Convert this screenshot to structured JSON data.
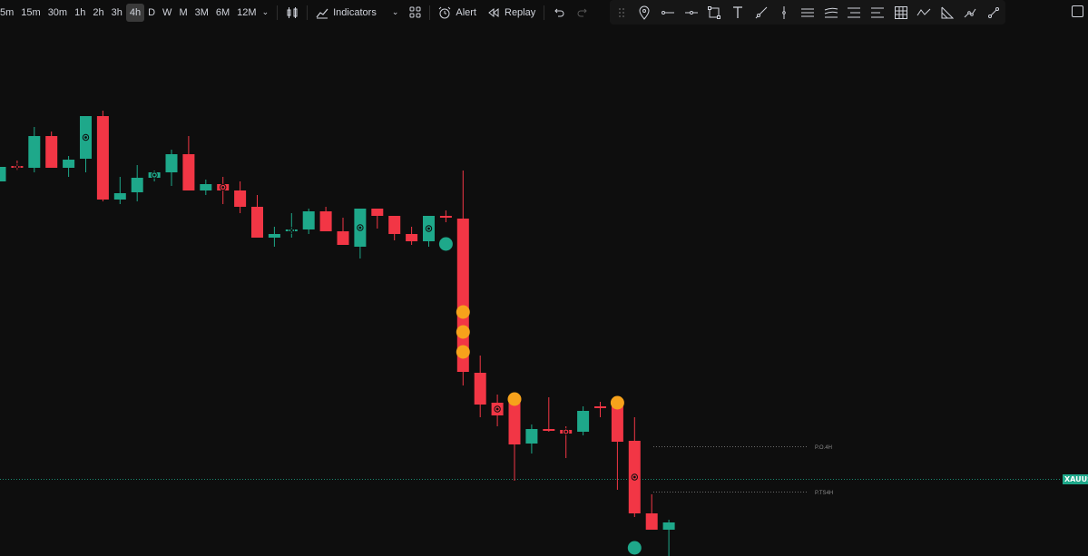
{
  "toolbar": {
    "timeframes": [
      "5m",
      "15m",
      "30m",
      "1h",
      "2h",
      "3h",
      "4h",
      "D",
      "W",
      "M",
      "3M",
      "6M",
      "12M"
    ],
    "active_timeframe": "4h",
    "indicators_label": "Indicators",
    "alert_label": "Alert",
    "replay_label": "Replay"
  },
  "drawing_tools": [
    "drag-handle-icon",
    "pin-icon",
    "trend-line-icon",
    "horizontal-ray-icon",
    "rectangle-icon",
    "text-icon",
    "ray-icon",
    "vertical-line-icon",
    "parallel-channel-icon",
    "pitchfork-icon",
    "fib-retracement-icon",
    "fib-extension-icon",
    "gann-box-icon",
    "zigzag-icon",
    "triangle-icon",
    "path-icon",
    "brush-icon"
  ],
  "chart": {
    "symbol_tag": "XAUUS",
    "labels": {
      "po4h": "P.O.4H",
      "pts4h": "P.TS4H"
    },
    "colors": {
      "up": "#1ea88a",
      "down": "#f23645",
      "signal_orange": "#f7a21b",
      "signal_teal": "#1ea88a",
      "background": "#0e0e0e"
    },
    "candles": [
      {
        "o": 200,
        "h": 195,
        "l": 160,
        "c": 184,
        "dot": false
      },
      {
        "o": 183,
        "h": 177,
        "l": 188,
        "c": 184,
        "dot": true
      },
      {
        "o": 185,
        "h": 140,
        "l": 190,
        "c": 150,
        "dot": false
      },
      {
        "o": 150,
        "h": 145,
        "l": 160,
        "c": 185,
        "dot": false
      },
      {
        "o": 185,
        "h": 172,
        "l": 195,
        "c": 176,
        "dot": false
      },
      {
        "o": 175,
        "h": 140,
        "l": 190,
        "c": 128,
        "dot": true
      },
      {
        "o": 128,
        "h": 122,
        "l": 222,
        "c": 220,
        "dot": false
      },
      {
        "o": 220,
        "h": 195,
        "l": 225,
        "c": 213,
        "dot": false
      },
      {
        "o": 212,
        "h": 182,
        "l": 222,
        "c": 196,
        "dot": false
      },
      {
        "o": 196,
        "h": 188,
        "l": 200,
        "c": 190,
        "dot": true
      },
      {
        "o": 190,
        "h": 165,
        "l": 205,
        "c": 170,
        "dot": false
      },
      {
        "o": 170,
        "h": 150,
        "l": 210,
        "c": 210,
        "dot": false
      },
      {
        "o": 210,
        "h": 198,
        "l": 215,
        "c": 203,
        "dot": false
      },
      {
        "o": 203,
        "h": 195,
        "l": 225,
        "c": 210,
        "dot": true
      },
      {
        "o": 210,
        "h": 200,
        "l": 235,
        "c": 228,
        "dot": false
      },
      {
        "o": 228,
        "h": 215,
        "l": 255,
        "c": 262,
        "dot": false
      },
      {
        "o": 262,
        "h": 250,
        "l": 272,
        "c": 258,
        "dot": false
      },
      {
        "o": 254,
        "h": 235,
        "l": 262,
        "c": 253,
        "dot": true
      },
      {
        "o": 253,
        "h": 230,
        "l": 258,
        "c": 233,
        "dot": false
      },
      {
        "o": 233,
        "h": 228,
        "l": 250,
        "c": 255,
        "dot": false
      },
      {
        "o": 255,
        "h": 240,
        "l": 270,
        "c": 270,
        "dot": false
      },
      {
        "o": 272,
        "h": 235,
        "l": 285,
        "c": 230,
        "dot": true
      },
      {
        "o": 230,
        "h": 230,
        "l": 252,
        "c": 238,
        "dot": false
      },
      {
        "o": 238,
        "h": 238,
        "l": 265,
        "c": 258,
        "dot": false
      },
      {
        "o": 258,
        "h": 250,
        "l": 270,
        "c": 266,
        "dot": false
      },
      {
        "o": 266,
        "h": 240,
        "l": 272,
        "c": 238,
        "dot": true
      },
      {
        "o": 238,
        "h": 232,
        "l": 245,
        "c": 239,
        "dot": false
      },
      {
        "o": 241,
        "h": 188,
        "l": 425,
        "c": 410,
        "dot": false
      },
      {
        "o": 411,
        "h": 392,
        "l": 460,
        "c": 446,
        "dot": false
      },
      {
        "o": 444,
        "h": 435,
        "l": 470,
        "c": 458,
        "dot": true
      },
      {
        "o": 444,
        "h": 440,
        "l": 530,
        "c": 490,
        "dot": false
      },
      {
        "o": 489,
        "h": 468,
        "l": 500,
        "c": 473,
        "dot": false
      },
      {
        "o": 473,
        "h": 438,
        "l": 476,
        "c": 475,
        "dot": false
      },
      {
        "o": 474,
        "h": 470,
        "l": 505,
        "c": 478,
        "dot": true
      },
      {
        "o": 476,
        "h": 448,
        "l": 480,
        "c": 453,
        "dot": false
      },
      {
        "o": 448,
        "h": 443,
        "l": 460,
        "c": 449,
        "dot": false
      },
      {
        "o": 448,
        "h": 440,
        "l": 540,
        "c": 487,
        "dot": false
      },
      {
        "o": 486,
        "h": 460,
        "l": 570,
        "c": 566,
        "dot": true
      },
      {
        "o": 566,
        "h": 545,
        "l": 583,
        "c": 584,
        "dot": false
      },
      {
        "o": 584,
        "h": 573,
        "l": 628,
        "c": 576,
        "dot": false
      }
    ],
    "signals": [
      {
        "candle": 26,
        "price": 269,
        "type": "teal"
      },
      {
        "candle": 27,
        "price": 344,
        "type": "orange"
      },
      {
        "candle": 27,
        "price": 366,
        "type": "orange"
      },
      {
        "candle": 27,
        "price": 388,
        "type": "orange"
      },
      {
        "candle": 30,
        "price": 440,
        "type": "orange"
      },
      {
        "candle": 36,
        "price": 444,
        "type": "orange"
      },
      {
        "candle": 37,
        "price": 604,
        "type": "teal"
      }
    ]
  }
}
